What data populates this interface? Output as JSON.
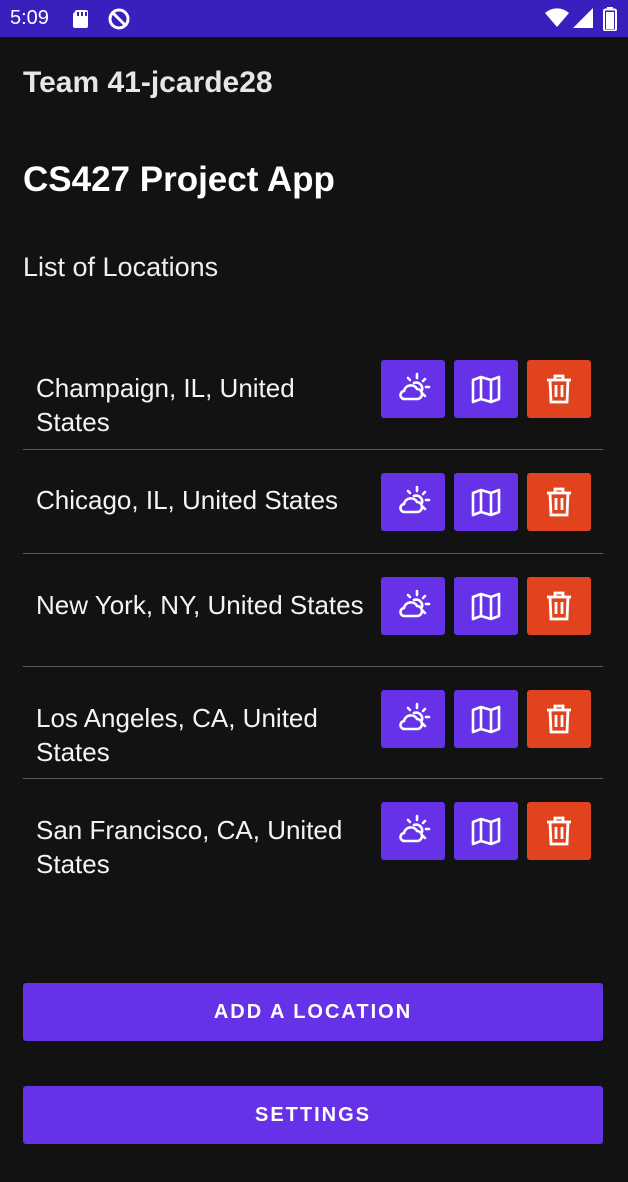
{
  "status_bar": {
    "time": "5:09",
    "icons": [
      "sd-card-icon",
      "do-not-disturb-icon",
      "wifi-icon",
      "signal-icon",
      "battery-icon"
    ]
  },
  "header": {
    "team": "Team 41-jcarde28",
    "app_title": "CS427 Project App",
    "list_label": "List of Locations"
  },
  "locations": [
    {
      "name": "Champaign, IL, United States"
    },
    {
      "name": "Chicago, IL, United States"
    },
    {
      "name": "New York, NY, United States"
    },
    {
      "name": "Los Angeles, CA, United States"
    },
    {
      "name": "San Francisco, CA, United States"
    }
  ],
  "row_buttons": {
    "weather_icon": "weather-icon",
    "map_icon": "map-icon",
    "delete_icon": "trash-icon"
  },
  "actions": {
    "add_location": "ADD A LOCATION",
    "settings": "SETTINGS"
  },
  "colors": {
    "status_bar": "#3a1fbf",
    "background": "#121212",
    "primary_button": "#6632e8",
    "delete_button": "#e0431e"
  }
}
